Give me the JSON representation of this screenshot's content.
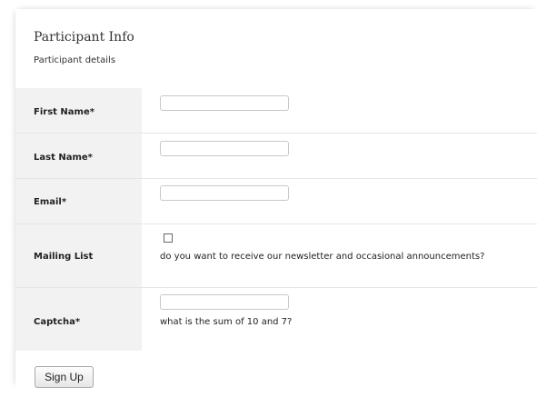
{
  "header": {
    "title": "Participant Info",
    "subtitle": "Participant details"
  },
  "fields": {
    "first_name": {
      "label": "First Name*",
      "value": ""
    },
    "last_name": {
      "label": "Last Name*",
      "value": ""
    },
    "email": {
      "label": "Email*",
      "value": ""
    },
    "mailing_list": {
      "label": "Mailing List",
      "checked": false,
      "help": "do you want to receive our newsletter and occasional announcements?"
    },
    "captcha": {
      "label": "Captcha*",
      "value": "",
      "help": "what is the sum of 10 and 7?"
    }
  },
  "footer": {
    "submit_label": "Sign Up"
  }
}
